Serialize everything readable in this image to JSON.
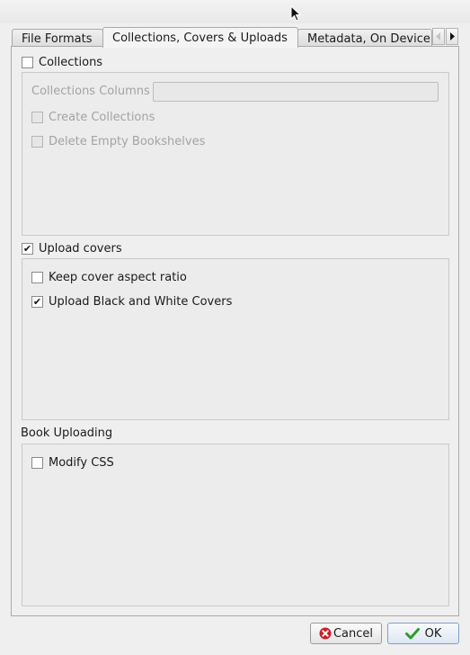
{
  "tabs": [
    {
      "label": "File Formats"
    },
    {
      "label": "Collections, Covers & Uploads"
    },
    {
      "label": "Metadata, On Device"
    }
  ],
  "collections": {
    "label": "Collections",
    "checked": false,
    "columns_label": "Collections Columns",
    "columns_value": "",
    "create_label": "Create Collections",
    "delete_label": "Delete Empty Bookshelves"
  },
  "covers": {
    "label": "Upload covers",
    "checked": true,
    "keep_aspect_label": "Keep cover aspect ratio",
    "keep_aspect_checked": false,
    "bw_label": "Upload Black and White Covers",
    "bw_checked": true
  },
  "uploading": {
    "label": "Book Uploading",
    "modify_css_label": "Modify CSS",
    "modify_css_checked": false
  },
  "buttons": {
    "cancel": "Cancel",
    "ok": "OK"
  },
  "icons": {
    "cancel": "cancel-icon",
    "ok": "checkmark-icon",
    "cursor": "mouse-cursor-icon"
  }
}
